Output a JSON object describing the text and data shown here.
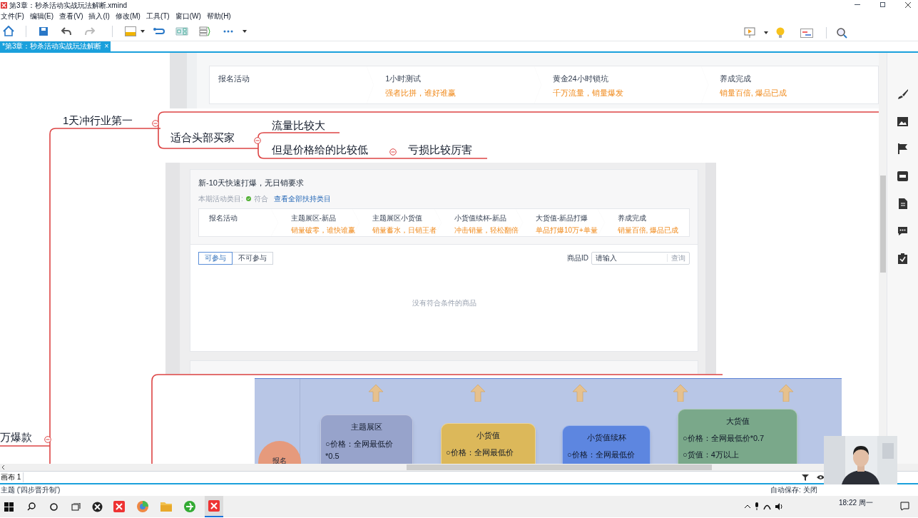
{
  "window": {
    "title": "第3章：秒杀活动实战玩法解断.xmind"
  },
  "menu": [
    "文件(F)",
    "编辑(E)",
    "查看(V)",
    "插入(I)",
    "修改(M)",
    "工具(T)",
    "窗口(W)",
    "帮助(H)"
  ],
  "document_tab": {
    "label": "*第3章：秒杀活动实战玩法解断",
    "close": "×",
    "selected": true
  },
  "mind_map": {
    "topics": [
      {
        "text": "1天冲行业第一"
      },
      {
        "text": "适合头部买家"
      },
      {
        "text": "流量比较大"
      },
      {
        "text": "但是价格给的比较低"
      },
      {
        "text": "亏损比较厉害"
      },
      {
        "text": "万爆款"
      }
    ]
  },
  "image_1": {
    "steps": [
      {
        "title": "报名活动"
      },
      {
        "title": "1小时测试",
        "subtitle": "强者比拼，谁好谁赢"
      },
      {
        "title": "黄金24小时锁坑",
        "subtitle": "千万流量，销量爆发"
      },
      {
        "title": "养成完成",
        "subtitle": "销量百倍, 爆品已成"
      }
    ]
  },
  "image_2": {
    "title": "新-10天快速打爆，无日销要求",
    "category_label": "本期活动类目:",
    "category_status": "符合",
    "category_link": "查看全部扶持类目",
    "steps": [
      {
        "title": "报名活动"
      },
      {
        "title": "主题展区-新品",
        "subtitle": "销量破零，谁快谁赢"
      },
      {
        "title": "主题展区小货值",
        "subtitle": "销量蓄水，日销王者"
      },
      {
        "title": "小货值续杯-新品",
        "subtitle": "冲击销量，轻松翻倍"
      },
      {
        "title": "大货值-新品打爆",
        "subtitle": "单品打爆10万+单量"
      },
      {
        "title": "养成完成",
        "subtitle": "销量百倍, 爆品已成"
      }
    ],
    "filters": [
      {
        "label": "可参与",
        "selected": true
      },
      {
        "label": "不可参与",
        "selected": false
      }
    ],
    "search": {
      "label": "商品ID",
      "placeholder": "请输入",
      "button": "查询"
    },
    "empty_message": "没有符合条件的商品"
  },
  "image_3": {
    "start": "报名",
    "stages": [
      {
        "title": "主题展区",
        "lines": [
          "○价格：全网最低价",
          "*0.5"
        ],
        "color": "#97a3cb"
      },
      {
        "title": "小货值",
        "lines": [
          "○价格：全网最低价"
        ],
        "color": "#dcb85a"
      },
      {
        "title": "小货值续杯",
        "lines": [
          "○价格：全网最低价"
        ],
        "color": "#5d86e0"
      },
      {
        "title": "大货值",
        "lines": [
          "○价格：全网最低价*0.7",
          "○货值：4万以上"
        ],
        "color": "#7aa88a"
      }
    ]
  },
  "sheet_tab": {
    "label": "画布 1"
  },
  "status_bar": {
    "topic": "主题 ('四步晋升制')",
    "autosave": "自动保存: 关闭"
  },
  "taskbar": {
    "time": "18:22 周一"
  }
}
